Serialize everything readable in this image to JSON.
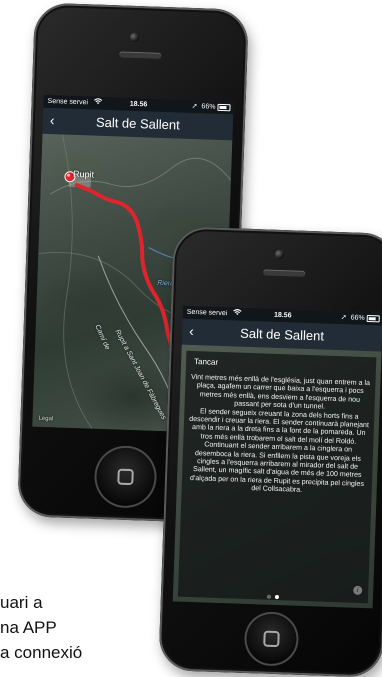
{
  "background_text": {
    "line1": "uari a",
    "line2": "na APP",
    "line3": "a connexió"
  },
  "colors": {
    "route": "#e0242e",
    "marker": "#e0242e",
    "nav_bar": "#222c36",
    "dot_active": "#ffffff",
    "dot_inactive": "#6a6a6a"
  },
  "back_phone": {
    "status_bar": {
      "carrier": "Sense servei",
      "wifi_icon": "wifi-icon",
      "time": "18.56",
      "location_icon": "➚",
      "battery_percent": "66%"
    },
    "nav": {
      "back_icon": "‹",
      "title": "Salt de Sallent"
    },
    "map": {
      "marker_label": "Rupit",
      "labels": {
        "riera": "Riera de Rupit",
        "cami": "Camí de",
        "road": "Rupit a Sant Joan de Fàbregues",
        "legal": "Legal"
      }
    }
  },
  "front_phone": {
    "status_bar": {
      "carrier": "Sense servei",
      "wifi_icon": "wifi-icon",
      "time": "18.56",
      "location_icon": "➚",
      "battery_percent": "66%"
    },
    "nav": {
      "back_icon": "‹",
      "title": "Salt de Sallent"
    },
    "info": {
      "close_label": "Tancar",
      "paragraph1": "Vint metres més enllà de l'església, just quan entrem a la plaça, agafem un carrer que baixa a l'esquerra i pocs metres més enllà, ens desviem a l'esquerra de nou passant per sota d'un tunnel.",
      "paragraph2": "El sender segueix creuant la zona dels horts fins a descendir i creuar la riera. El sender continuarà planejant amb la riera a la dreta fins a la font de la pomareda. Un tros més enllà trobarem el salt del molí del Roldó. Continuant el sender arribarem a la cinglera on desemboca la riera. Si enfilem la pista que voreja els cingles a l'esquerra arribarem al mirador del salt de Sallent, un magífic salt d'aigua de més de 100 metres d'alçada per on la riera de Rupit es precipita pel cingles del Collsacabra.",
      "page_count": 2,
      "active_page": 2,
      "info_icon": "i"
    }
  }
}
